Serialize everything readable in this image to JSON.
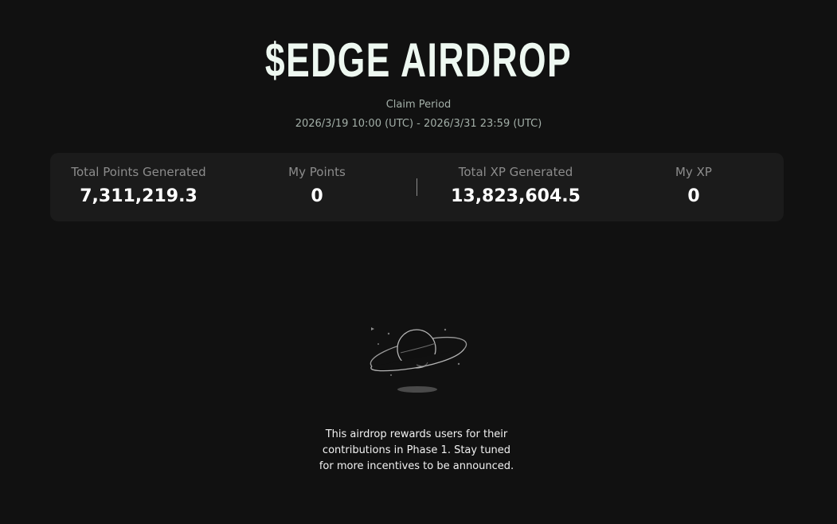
{
  "header": {
    "title": "$EDGE AIRDROP",
    "claim_label": "Claim Period",
    "claim_range": "2026/3/19 10:00 (UTC) - 2026/3/31 23:59 (UTC)"
  },
  "stats": [
    {
      "label": "Total Points Generated",
      "value": "7,311,219.3"
    },
    {
      "label": "My Points",
      "value": "0"
    },
    {
      "label": "Total XP Generated",
      "value": "13,823,604.5"
    },
    {
      "label": "My XP",
      "value": "0"
    }
  ],
  "empty_state": {
    "icon": "planet-icon",
    "message": "This airdrop rewards users for their contributions in Phase 1. Stay tuned for more incentives to be announced."
  },
  "colors": {
    "background": "#111111",
    "card": "#1b1b1b",
    "title": "#eef8f1",
    "muted": "#8c8c8c"
  }
}
